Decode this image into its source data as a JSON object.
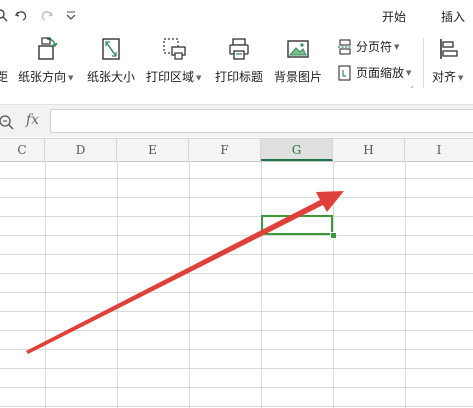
{
  "menu": {
    "tab_start": "开始",
    "tab_insert": "插入"
  },
  "ribbon": {
    "partial_left": "距",
    "orientation": "纸张方向",
    "size": "纸张大小",
    "print_area": "打印区域",
    "print_titles": "打印标题",
    "background": "背景图片",
    "page_break": "分页符",
    "page_zoom": "页面缩放",
    "align": "对齐"
  },
  "formula_bar": {
    "fx": "fx",
    "value": ""
  },
  "columns": [
    "C",
    "D",
    "E",
    "F",
    "G",
    "H",
    "I"
  ],
  "active_column": "G",
  "colors": {
    "accent": "#217346",
    "arrow": "#e0403a"
  }
}
